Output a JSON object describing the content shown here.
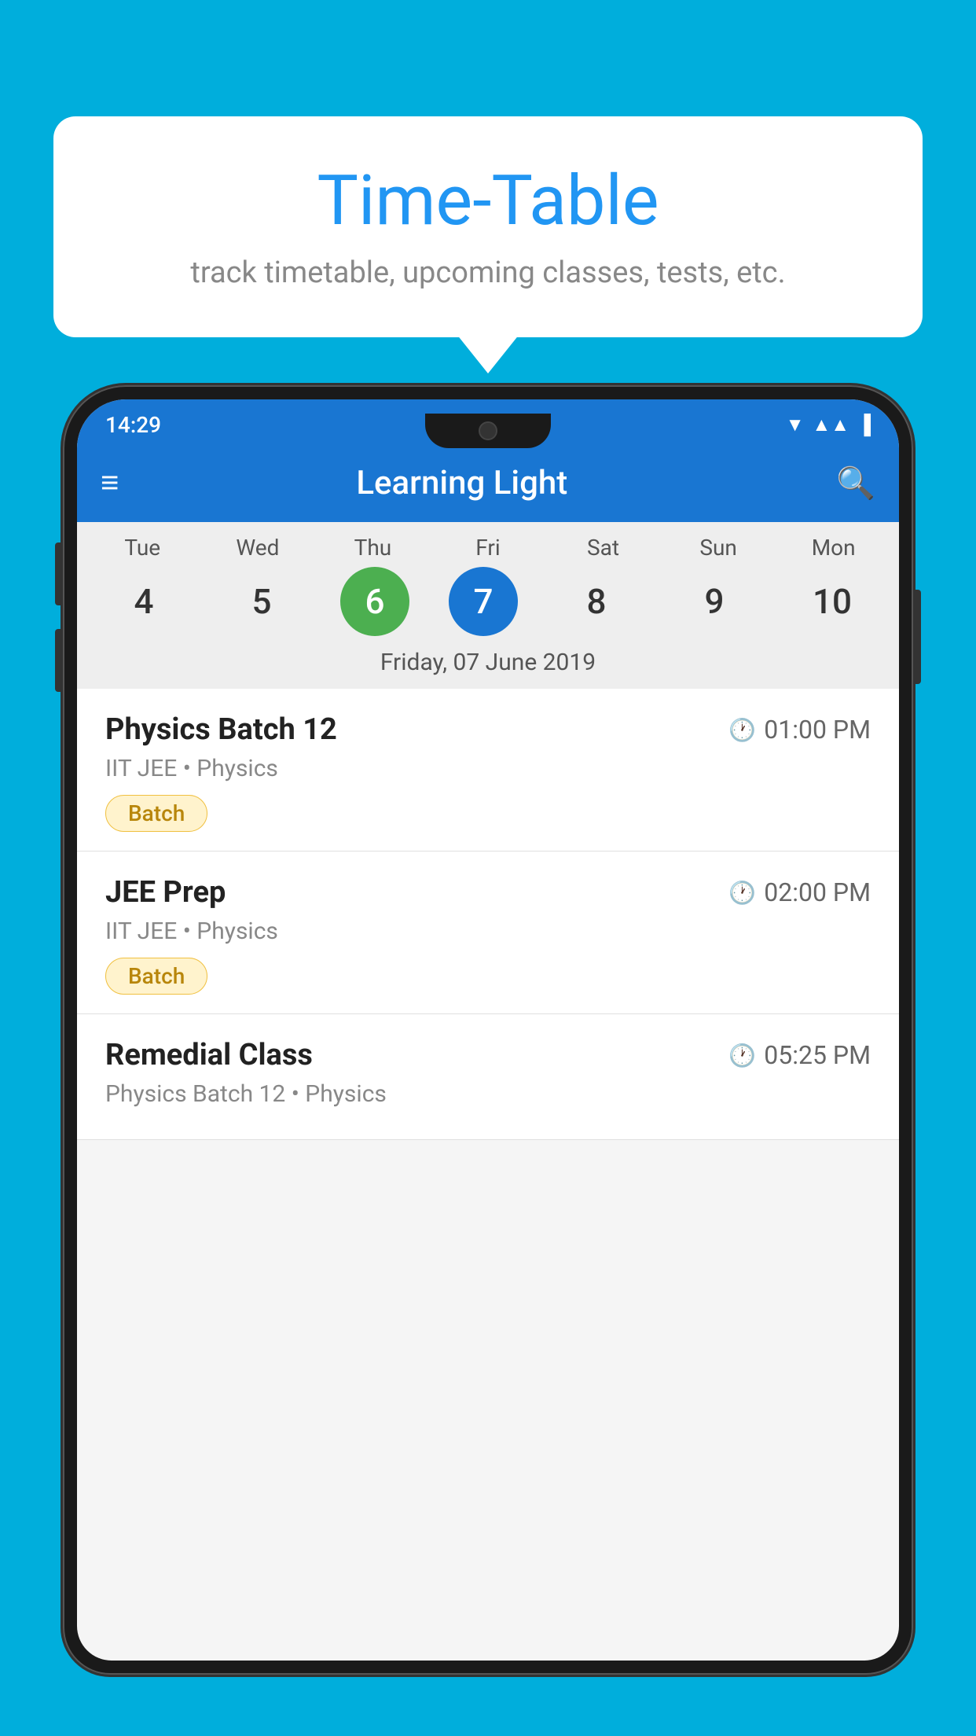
{
  "background_color": "#00AEDC",
  "bubble": {
    "title": "Time-Table",
    "subtitle": "track timetable, upcoming classes, tests, etc."
  },
  "status_bar": {
    "time": "14:29"
  },
  "app_bar": {
    "title": "Learning Light"
  },
  "calendar": {
    "days": [
      {
        "label": "Tue",
        "num": "4"
      },
      {
        "label": "Wed",
        "num": "5"
      },
      {
        "label": "Thu",
        "num": "6",
        "state": "today"
      },
      {
        "label": "Fri",
        "num": "7",
        "state": "selected"
      },
      {
        "label": "Sat",
        "num": "8"
      },
      {
        "label": "Sun",
        "num": "9"
      },
      {
        "label": "Mon",
        "num": "10"
      }
    ],
    "selected_date_label": "Friday, 07 June 2019"
  },
  "schedule": [
    {
      "title": "Physics Batch 12",
      "time": "01:00 PM",
      "meta": "IIT JEE • Physics",
      "badge": "Batch"
    },
    {
      "title": "JEE Prep",
      "time": "02:00 PM",
      "meta": "IIT JEE • Physics",
      "badge": "Batch"
    },
    {
      "title": "Remedial Class",
      "time": "05:25 PM",
      "meta": "Physics Batch 12 • Physics",
      "badge": ""
    }
  ]
}
